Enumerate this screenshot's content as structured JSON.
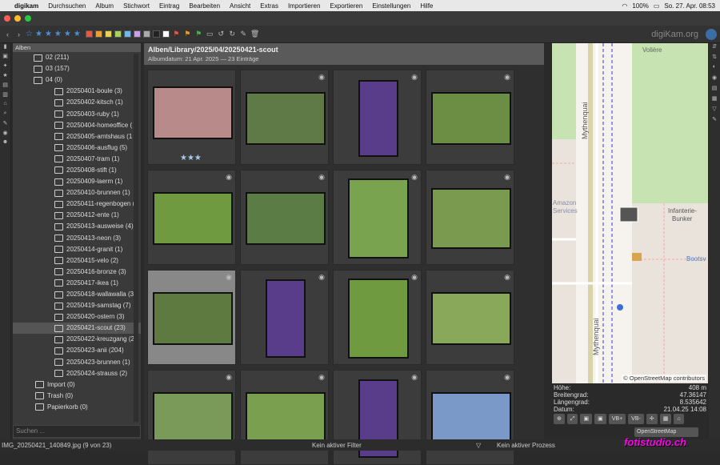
{
  "menu": {
    "apple": "",
    "app": "digikam",
    "items": [
      "Durchsuchen",
      "Album",
      "Stichwort",
      "Eintrag",
      "Bearbeiten",
      "Ansicht",
      "Extras",
      "Importieren",
      "Exportieren",
      "Einstellungen",
      "Hilfe"
    ],
    "battery": "100%",
    "clock": "So. 27. Apr.  08:53"
  },
  "brand": "digiKam.org",
  "albums": {
    "header": "Alben",
    "rows": [
      {
        "label": "02 (211)",
        "indent": 1
      },
      {
        "label": "03 (157)",
        "indent": 1
      },
      {
        "label": "04 (0)",
        "indent": 1
      },
      {
        "label": "20250401-boule (3)",
        "indent": 2
      },
      {
        "label": "20250402-kitsch (1)",
        "indent": 2
      },
      {
        "label": "20250403-ruby (1)",
        "indent": 2
      },
      {
        "label": "20250404-homeoffice (",
        "indent": 2
      },
      {
        "label": "20250405-amtshaus (1",
        "indent": 2
      },
      {
        "label": "20250406-ausflug (5)",
        "indent": 2
      },
      {
        "label": "20250407-tram (1)",
        "indent": 2
      },
      {
        "label": "20250408-stift (1)",
        "indent": 2
      },
      {
        "label": "20250409-laerm (1)",
        "indent": 2
      },
      {
        "label": "20250410-brunnen (1)",
        "indent": 2
      },
      {
        "label": "20250411-regenbogen (",
        "indent": 2
      },
      {
        "label": "20250412-ente (1)",
        "indent": 2
      },
      {
        "label": "20250413-ausweise (4)",
        "indent": 2
      },
      {
        "label": "20250413-neon (3)",
        "indent": 2
      },
      {
        "label": "20250414-granit (1)",
        "indent": 2
      },
      {
        "label": "20250415-velo (2)",
        "indent": 2
      },
      {
        "label": "20250416-bronze (3)",
        "indent": 2
      },
      {
        "label": "20250417-ikea (1)",
        "indent": 2
      },
      {
        "label": "20250418-wallawalla (3",
        "indent": 2
      },
      {
        "label": "20250419-samstag (7)",
        "indent": 2
      },
      {
        "label": "20250420-ostern (3)",
        "indent": 2
      },
      {
        "label": "20250421-scout (23)",
        "indent": 2,
        "selected": true
      },
      {
        "label": "20250422-kreuzgang (2",
        "indent": 2
      },
      {
        "label": "20250423-anii (204)",
        "indent": 2
      },
      {
        "label": "20250423-brunnen (1)",
        "indent": 2
      },
      {
        "label": "20250424-strauss (2)",
        "indent": 2
      },
      {
        "label": "Import (0)",
        "indent": 0
      },
      {
        "label": "Trash (0)",
        "indent": 0
      },
      {
        "label": "Papierkorb (0)",
        "indent": 0
      }
    ],
    "search_placeholder": "Suchen ..."
  },
  "main": {
    "title": "Alben/Library/2025/04/20250421-scout",
    "subtitle": "Albumdatum: 21 Apr. 2025 — 23 Einträge"
  },
  "map": {
    "labels": [
      "Volière",
      "Mythenquai",
      "Amazon",
      "Services",
      "Infanterie-",
      "Bunker",
      "Bootsv",
      "Mythenquai",
      "© OpenStreetMap contributors"
    ]
  },
  "geo": {
    "rows": [
      {
        "k": "Höhe:",
        "v": "408 m"
      },
      {
        "k": "Breitengrad:",
        "v": "47.36147"
      },
      {
        "k": "Längengrad:",
        "v": "8.535642"
      },
      {
        "k": "Datum:",
        "v": "21.04.25 14:08"
      }
    ],
    "buttons": [
      "⊕",
      "⤢",
      "▣",
      "▣",
      "VB+",
      "VB-",
      "✢",
      "▦",
      "⌂"
    ],
    "provider": "OpenStreetMap"
  },
  "status": {
    "file": "IMG_20250421_140849.jpg (9 von 23)",
    "filter": "Kein aktiver Filter",
    "process": "Kein aktiver Prozess"
  },
  "watermark": "fotistudio.ch",
  "colors": {
    "labels": [
      "#e05a4a",
      "#e8a030",
      "#e8d050",
      "#a8d060",
      "#70b8e8",
      "#c8a0e8",
      "#aaaaaa",
      "#222222",
      "#ffffff"
    ]
  }
}
